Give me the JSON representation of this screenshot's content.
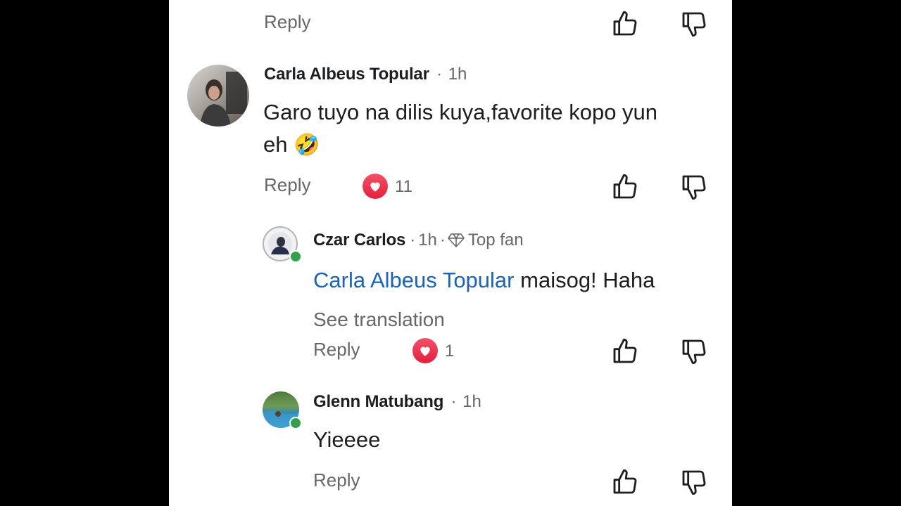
{
  "comments": [
    {
      "author": "Carla Albeus Topular",
      "time": "1h",
      "text_line1": "Garo tuyo na dilis kuya,favorite kopo yun",
      "text_line2": "eh",
      "emoji": "🤣",
      "reply_label": "Reply",
      "reaction_count": "11"
    },
    {
      "author": "Czar Carlos",
      "time": "1h",
      "badge": "Top fan",
      "mention": "Carla Albeus Topular",
      "text": "maisog! Haha",
      "see_translation": "See translation",
      "reply_label": "Reply",
      "reaction_count": "1"
    },
    {
      "author": "Glenn Matubang",
      "time": "1h",
      "text": "Yieeee",
      "reply_label": "Reply"
    }
  ],
  "top_reply_label": "Reply",
  "separator": "·",
  "icons": {
    "like": "thumbs-up-icon",
    "dislike": "thumbs-down-icon",
    "reaction": "heart-icon",
    "badge": "diamond-icon"
  },
  "colors": {
    "mention": "#1b64b5",
    "heart": "#e41e3f",
    "online": "#31a24c"
  }
}
